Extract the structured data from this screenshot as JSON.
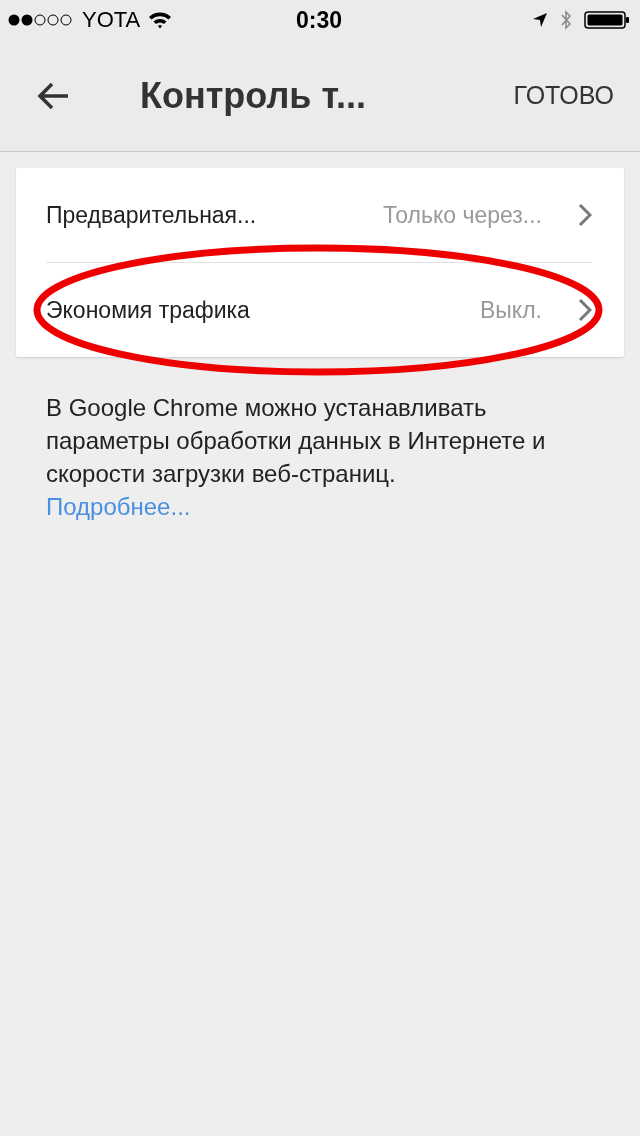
{
  "status_bar": {
    "carrier": "YOTA",
    "time": "0:30"
  },
  "header": {
    "title": "Контроль т...",
    "action": "ГОТОВО"
  },
  "settings": [
    {
      "label": "Предварительная...",
      "value": "Только через..."
    },
    {
      "label": "Экономия трафика",
      "value": "Выкл."
    }
  ],
  "description": "В Google Chrome можно устанавливать параметры обработки данных в Интернете и скорости загрузки веб-страниц.",
  "link": "Подробнее..."
}
